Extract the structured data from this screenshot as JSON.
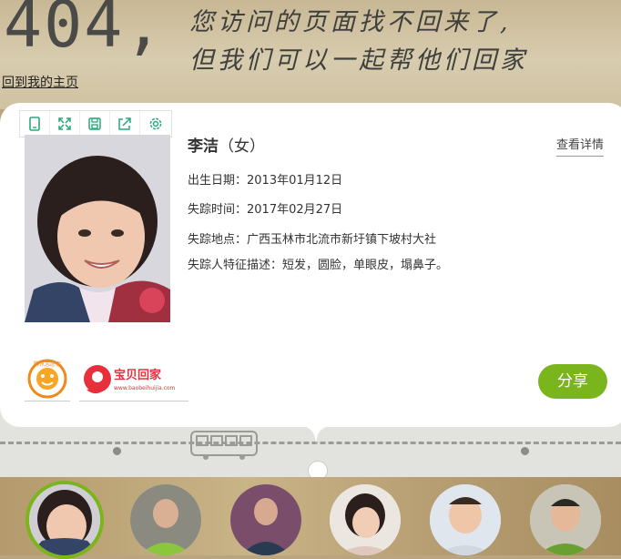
{
  "header": {
    "code": "404,",
    "line1": "您访问的页面找不回来了,",
    "line2": "但我们可以一起帮他们回家",
    "home_link": "回到我的主页"
  },
  "toolbar": {
    "icons": [
      "phone-icon",
      "expand-icon",
      "save-icon",
      "share-out-icon",
      "gear-icon"
    ]
  },
  "person": {
    "name": "李洁",
    "gender": "（女）",
    "detail_link": "查看详情",
    "birth": "出生日期：2013年01月12日",
    "missing_time": "失踪时间：2017年02月27日",
    "missing_place": "失踪地点：广西玉林市北流市新圩镇下坡村大社",
    "features": "失踪人特征描述：短发，圆脸，单眼皮，塌鼻子。"
  },
  "logos": {
    "volunteer_caption": "腾讯志愿者",
    "baobei_name": "宝贝回家",
    "baobei_url": "www.baobeihuijia.com"
  },
  "share_label": "分享",
  "colors": {
    "accent": "#7ab51d",
    "text": "#333333"
  }
}
